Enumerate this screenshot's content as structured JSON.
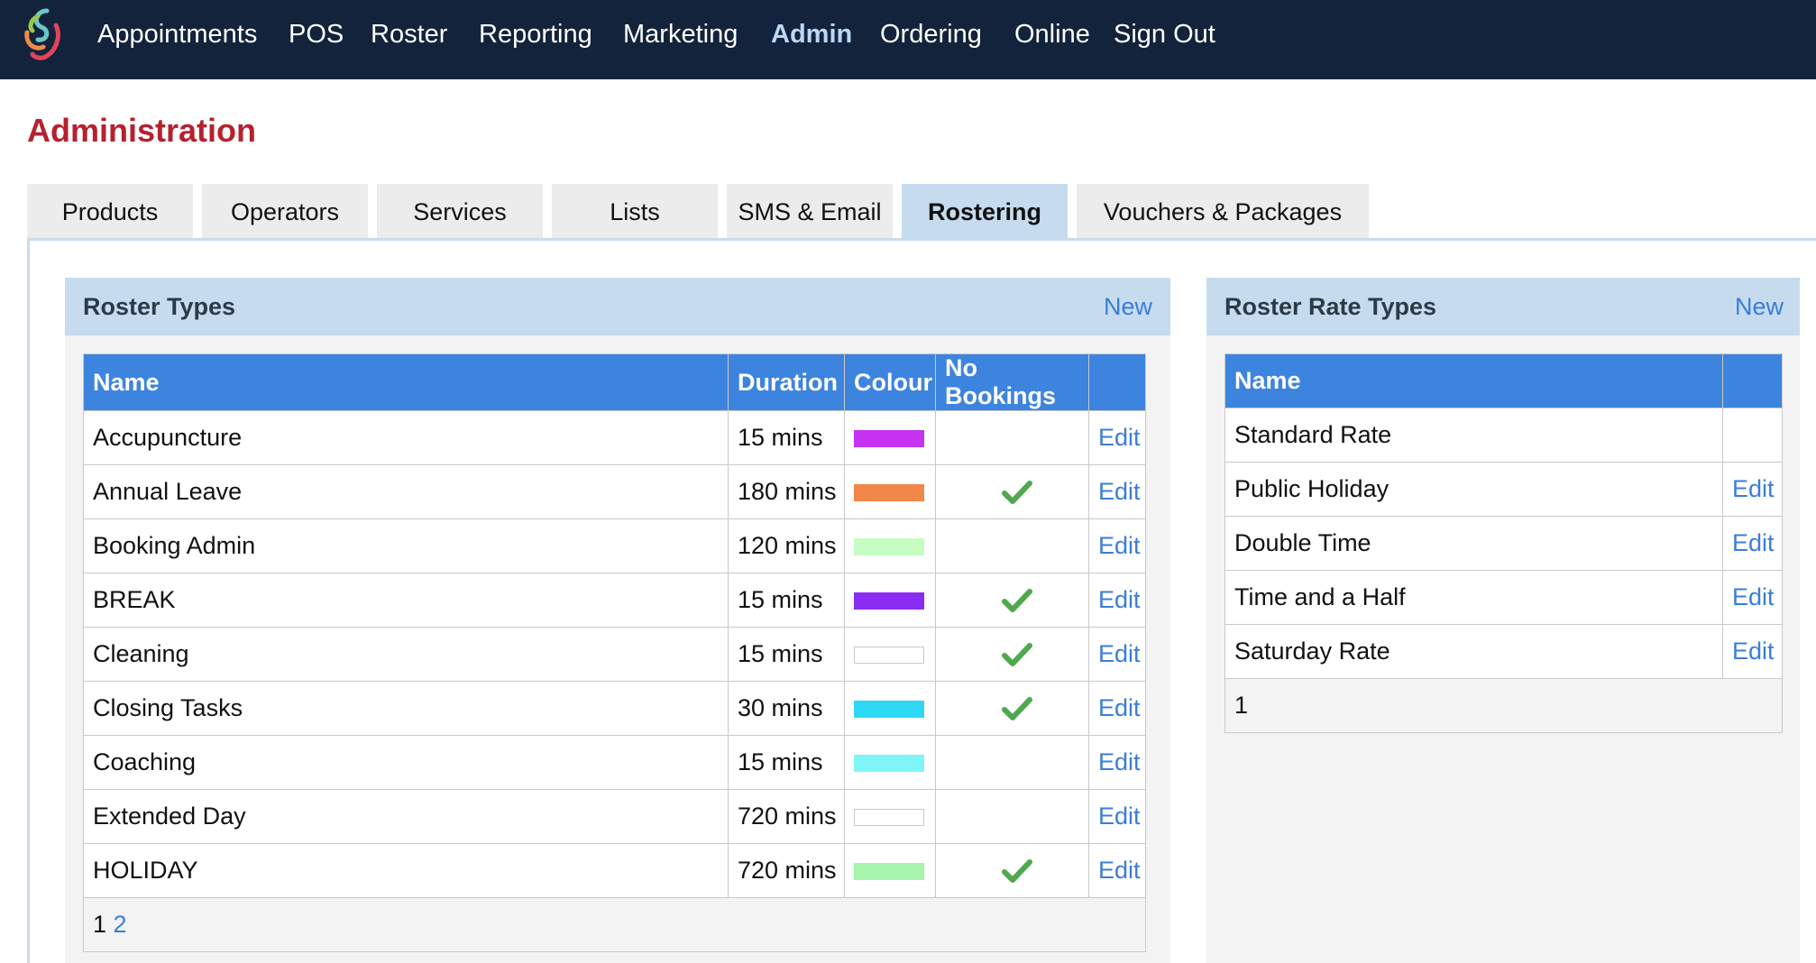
{
  "nav": {
    "items": [
      {
        "label": "Appointments"
      },
      {
        "label": "POS"
      },
      {
        "label": "Roster"
      },
      {
        "label": "Reporting"
      },
      {
        "label": "Marketing"
      },
      {
        "label": "Admin"
      },
      {
        "label": "Ordering"
      },
      {
        "label": "Online"
      },
      {
        "label": "Sign Out"
      }
    ],
    "active": "Admin"
  },
  "page": {
    "title": "Administration"
  },
  "tabs": [
    {
      "label": "Products"
    },
    {
      "label": "Operators"
    },
    {
      "label": "Services"
    },
    {
      "label": "Lists"
    },
    {
      "label": "SMS & Email"
    },
    {
      "label": "Rostering"
    },
    {
      "label": "Vouchers & Packages"
    }
  ],
  "active_tab": "Rostering",
  "roster_types": {
    "title": "Roster Types",
    "new_label": "New",
    "columns": {
      "name": "Name",
      "duration": "Duration",
      "colour": "Colour",
      "no_bookings": "No Bookings"
    },
    "rows": [
      {
        "name": "Accupuncture",
        "duration": "15 mins",
        "colour": "#c532f0",
        "no_bookings": false,
        "action": "Edit"
      },
      {
        "name": "Annual Leave",
        "duration": "180 mins",
        "colour": "#f2874a",
        "no_bookings": true,
        "action": "Edit"
      },
      {
        "name": "Booking Admin",
        "duration": "120 mins",
        "colour": "#c6fdc2",
        "no_bookings": false,
        "action": "Edit"
      },
      {
        "name": "BREAK",
        "duration": "15 mins",
        "colour": "#8b2cf2",
        "no_bookings": true,
        "action": "Edit"
      },
      {
        "name": "Cleaning",
        "duration": "15 mins",
        "colour": "#ffffff",
        "no_bookings": true,
        "action": "Edit"
      },
      {
        "name": "Closing Tasks",
        "duration": "30 mins",
        "colour": "#2fd9f6",
        "no_bookings": true,
        "action": "Edit"
      },
      {
        "name": "Coaching",
        "duration": "15 mins",
        "colour": "#7ef5f6",
        "no_bookings": false,
        "action": "Edit"
      },
      {
        "name": "Extended Day",
        "duration": "720 mins",
        "colour": "#ffffff",
        "no_bookings": false,
        "action": "Edit"
      },
      {
        "name": "HOLIDAY",
        "duration": "720 mins",
        "colour": "#a7f5ad",
        "no_bookings": true,
        "action": "Edit"
      }
    ],
    "pagination": {
      "current": "1",
      "pages": [
        "2"
      ]
    }
  },
  "rate_types": {
    "title": "Roster Rate Types",
    "new_label": "New",
    "columns": {
      "name": "Name"
    },
    "rows": [
      {
        "name": "Standard Rate",
        "action": ""
      },
      {
        "name": "Public Holiday",
        "action": "Edit"
      },
      {
        "name": "Double Time",
        "action": "Edit"
      },
      {
        "name": "Time and a Half",
        "action": "Edit"
      },
      {
        "name": "Saturday Rate",
        "action": "Edit"
      }
    ],
    "pagination": {
      "current": "1"
    }
  },
  "colors": {
    "topbar": "#13233b",
    "accent_title": "#b4222e",
    "link": "#3a7ddc",
    "table_header": "#3d84df",
    "panel_header": "#c6dcee"
  }
}
